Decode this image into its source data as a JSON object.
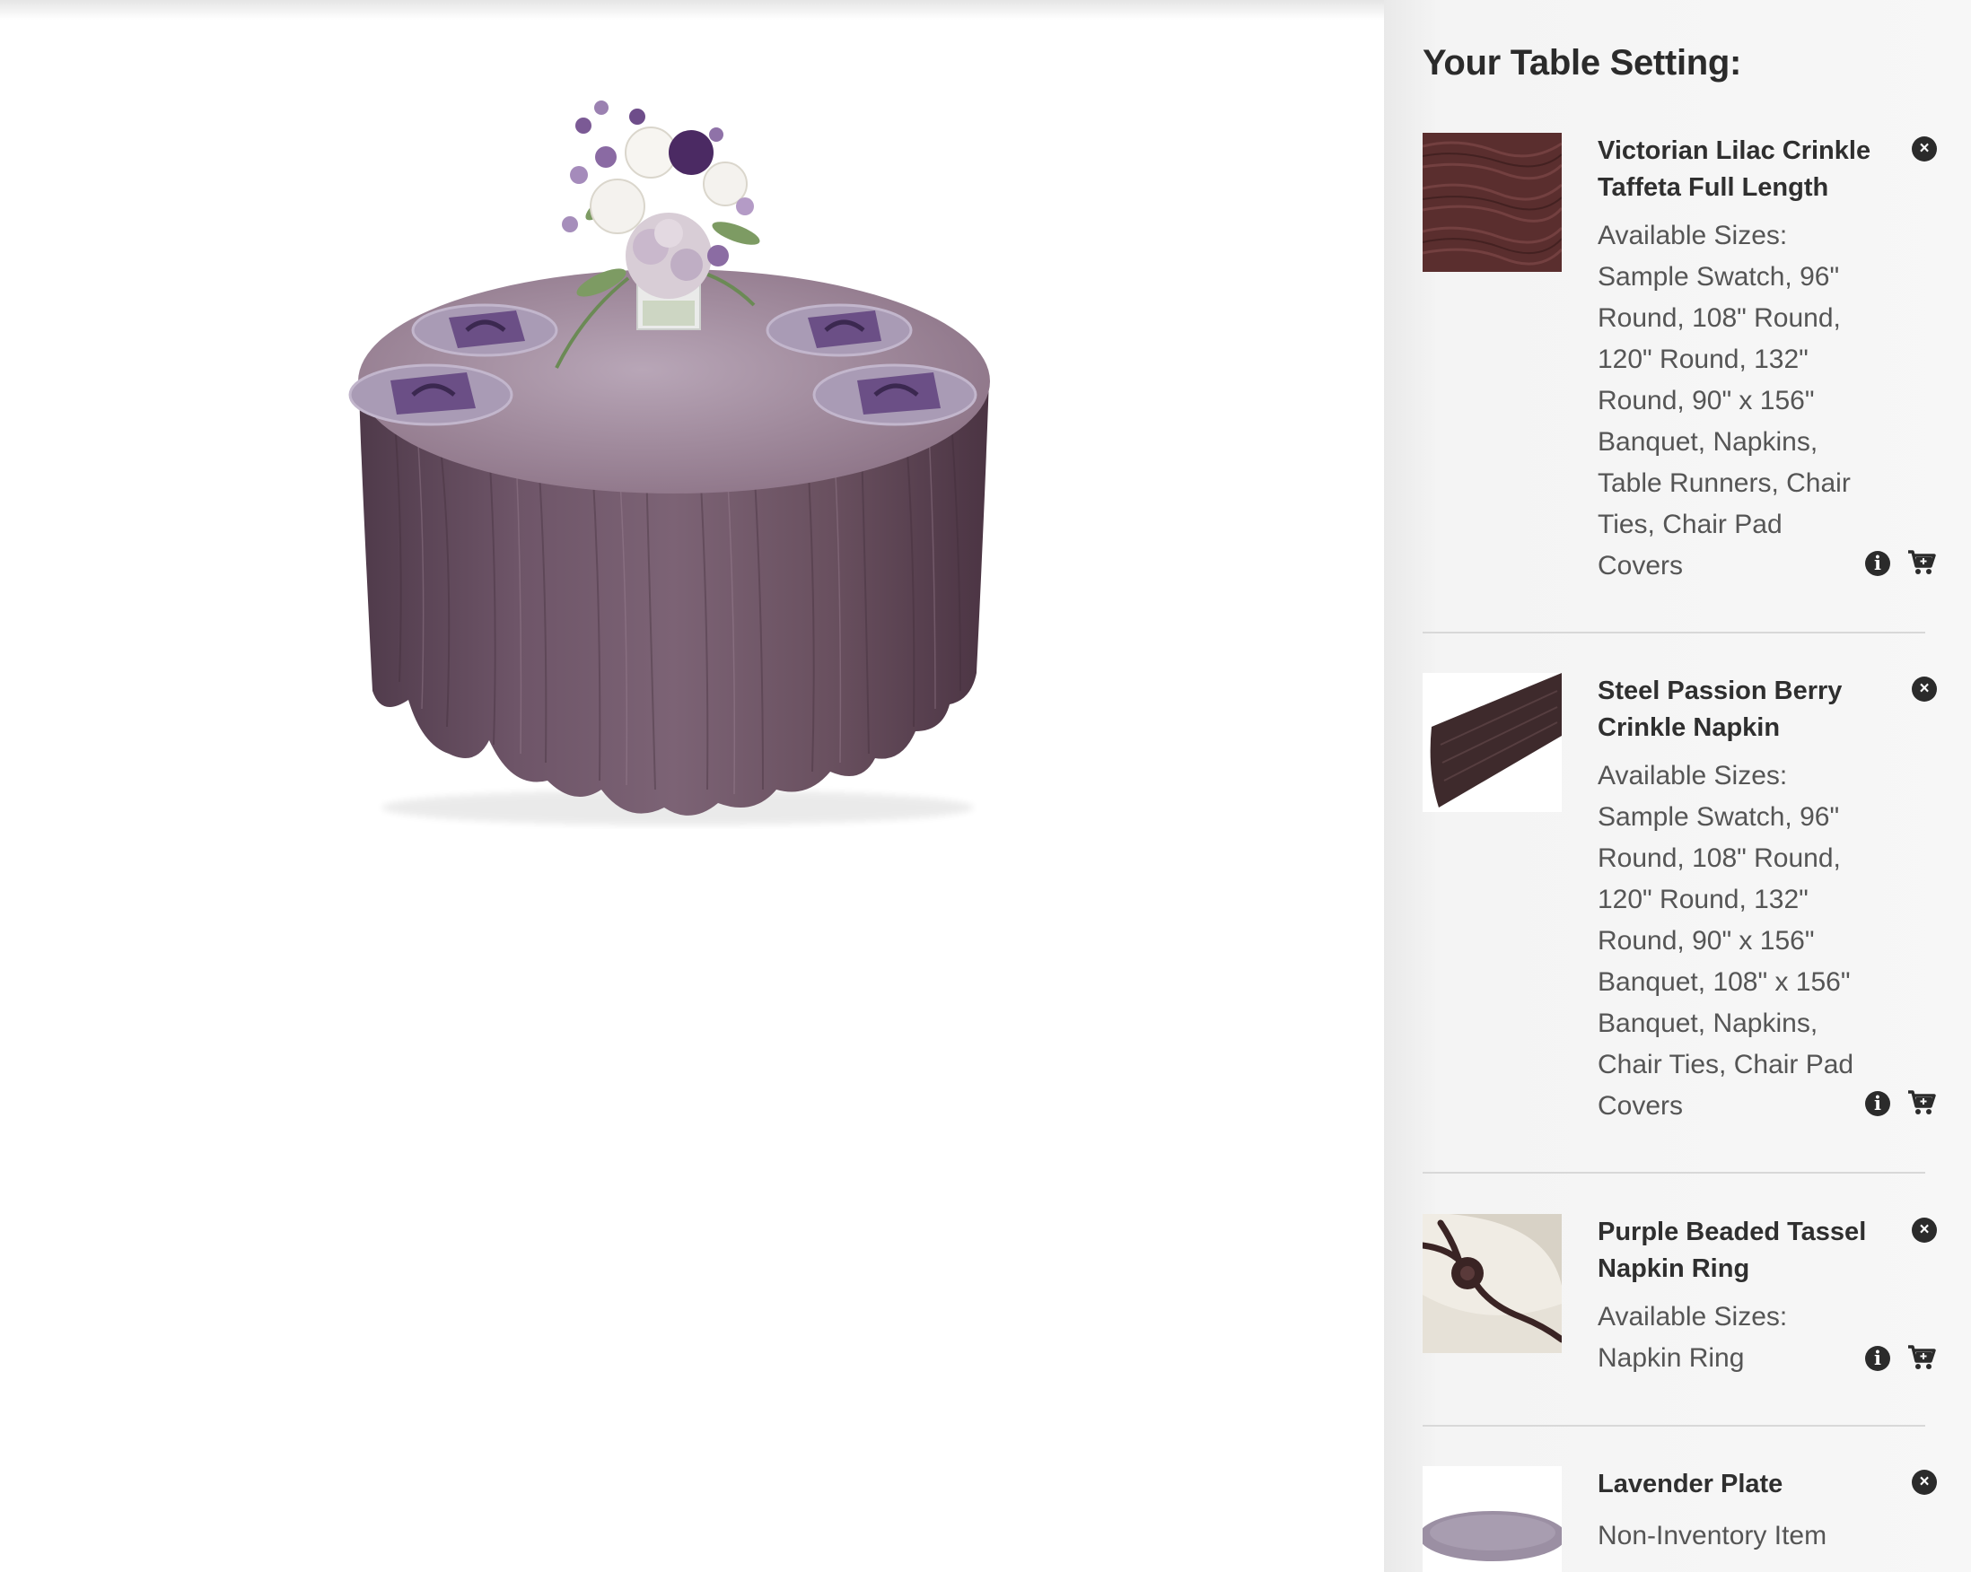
{
  "sidebar": {
    "title": "Your Table Setting:",
    "items": [
      {
        "name": "Victorian Lilac Crinkle Taffeta Full Length",
        "sizes_label": "Available Sizes:",
        "sizes": "Sample Swatch, 96\" Round, 108\" Round, 120\" Round, 132\" Round, 90\" x 156\" Banquet, Napkins, Table Runners, Chair Ties, Chair Pad Covers",
        "thumb_color": "#5a2e2e"
      },
      {
        "name": "Steel Passion Berry Crinkle Napkin",
        "sizes_label": "Available Sizes:",
        "sizes": "Sample Swatch, 96\" Round, 108\" Round, 120\" Round, 132\" Round, 90\" x 156\" Banquet, 108\" x 156\" Banquet, Napkins, Chair Ties, Chair Pad Covers",
        "thumb_color": "#3e2a2c"
      },
      {
        "name": "Purple Beaded Tassel Napkin Ring",
        "sizes_label": "Available Sizes:",
        "sizes": "Napkin Ring",
        "thumb_color": "#3a2424"
      },
      {
        "name": "Lavender Plate",
        "sizes_label": "Non-Inventory Item",
        "sizes": "",
        "thumb_color": "#9b8fa3"
      }
    ],
    "remove_icon": "×",
    "info_icon": "i"
  },
  "colors": {
    "tablecloth": "#7a5f73",
    "tablecloth_top": "#a48ea1",
    "plate": "#a99bb5",
    "napkin": "#6b4f86"
  }
}
